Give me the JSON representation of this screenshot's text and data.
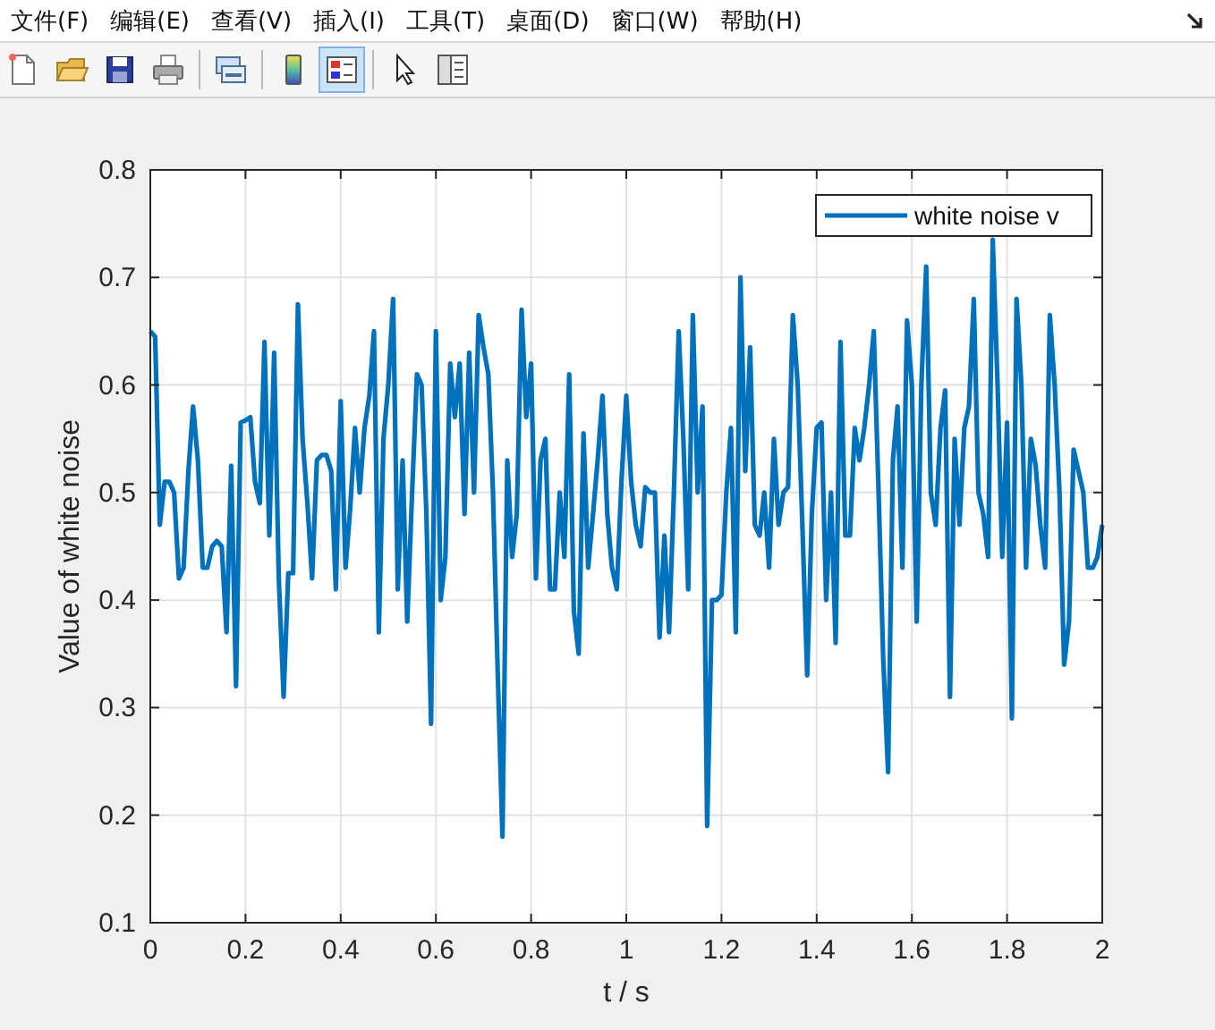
{
  "menu": [
    "文件(F)",
    "编辑(E)",
    "查看(V)",
    "插入(I)",
    "工具(T)",
    "桌面(D)",
    "窗口(W)",
    "帮助(H)"
  ],
  "toolbar": [
    {
      "kind": "new",
      "selected": false
    },
    {
      "kind": "open",
      "selected": false
    },
    {
      "kind": "save",
      "selected": false
    },
    {
      "kind": "print",
      "selected": false
    },
    {
      "kind": "separator"
    },
    {
      "kind": "link",
      "selected": false
    },
    {
      "kind": "separator"
    },
    {
      "kind": "colorbar",
      "selected": false
    },
    {
      "kind": "legend",
      "selected": true
    },
    {
      "kind": "separator"
    },
    {
      "kind": "pointer",
      "selected": false
    },
    {
      "kind": "inspector",
      "selected": false
    }
  ],
  "plot": {
    "chart_data": {
      "type": "line",
      "grid": true,
      "xlabel": "t / s",
      "ylabel": "Value of white noise",
      "xlim": [
        0,
        2
      ],
      "ylim": [
        0.1,
        0.8
      ],
      "xticks": [
        0,
        0.2,
        0.4,
        0.6,
        0.8,
        1,
        1.2,
        1.4,
        1.6,
        1.8,
        2
      ],
      "yticks": [
        0.1,
        0.2,
        0.3,
        0.4,
        0.5,
        0.6,
        0.7,
        0.8
      ],
      "x": [
        0,
        0.01,
        0.02,
        0.03,
        0.04,
        0.05,
        0.06,
        0.07,
        0.08,
        0.09,
        0.1,
        0.11,
        0.12,
        0.13,
        0.14,
        0.15,
        0.16,
        0.17,
        0.18,
        0.19,
        0.2,
        0.21,
        0.22,
        0.23,
        0.24,
        0.25,
        0.26,
        0.27,
        0.28,
        0.29,
        0.3,
        0.31,
        0.32,
        0.33,
        0.34,
        0.35,
        0.36,
        0.37,
        0.38,
        0.39,
        0.4,
        0.41,
        0.42,
        0.43,
        0.44,
        0.45,
        0.46,
        0.47,
        0.48,
        0.49,
        0.5,
        0.51,
        0.52,
        0.53,
        0.54,
        0.55,
        0.56,
        0.57,
        0.58,
        0.59,
        0.6,
        0.61,
        0.62,
        0.63,
        0.64,
        0.65,
        0.66,
        0.67,
        0.68,
        0.69,
        0.7,
        0.71,
        0.72,
        0.73,
        0.74,
        0.75,
        0.76,
        0.77,
        0.78,
        0.79,
        0.8,
        0.81,
        0.82,
        0.83,
        0.84,
        0.85,
        0.86,
        0.87,
        0.88,
        0.89,
        0.9,
        0.91,
        0.92,
        0.93,
        0.94,
        0.95,
        0.96,
        0.97,
        0.98,
        0.99,
        1,
        1.01,
        1.02,
        1.03,
        1.04,
        1.05,
        1.06,
        1.07,
        1.08,
        1.09,
        1.1,
        1.11,
        1.12,
        1.13,
        1.14,
        1.15,
        1.16,
        1.17,
        1.18,
        1.19,
        1.2,
        1.21,
        1.22,
        1.23,
        1.24,
        1.25,
        1.26,
        1.27,
        1.28,
        1.29,
        1.3,
        1.31,
        1.32,
        1.33,
        1.34,
        1.35,
        1.36,
        1.37,
        1.38,
        1.39,
        1.4,
        1.41,
        1.42,
        1.43,
        1.44,
        1.45,
        1.46,
        1.47,
        1.48,
        1.49,
        1.5,
        1.51,
        1.52,
        1.53,
        1.54,
        1.55,
        1.56,
        1.57,
        1.58,
        1.59,
        1.6,
        1.61,
        1.62,
        1.63,
        1.64,
        1.65,
        1.66,
        1.67,
        1.68,
        1.69,
        1.7,
        1.71,
        1.72,
        1.73,
        1.74,
        1.75,
        1.76,
        1.77,
        1.78,
        1.79,
        1.8,
        1.81,
        1.82,
        1.83,
        1.84,
        1.85,
        1.86,
        1.87,
        1.88,
        1.89,
        1.9,
        1.91,
        1.92,
        1.93,
        1.94,
        1.95,
        1.96,
        1.97,
        1.98,
        1.99,
        2
      ],
      "series": [
        {
          "name": "white noise v",
          "color": "#0072bd",
          "values": [
            0.65,
            0.645,
            0.47,
            0.51,
            0.51,
            0.5,
            0.42,
            0.43,
            0.52,
            0.58,
            0.53,
            0.43,
            0.43,
            0.45,
            0.455,
            0.45,
            0.37,
            0.525,
            0.32,
            0.565,
            0.567,
            0.57,
            0.51,
            0.49,
            0.64,
            0.46,
            0.63,
            0.42,
            0.31,
            0.425,
            0.425,
            0.675,
            0.55,
            0.49,
            0.42,
            0.53,
            0.535,
            0.535,
            0.52,
            0.41,
            0.585,
            0.43,
            0.485,
            0.56,
            0.5,
            0.56,
            0.59,
            0.65,
            0.37,
            0.55,
            0.6,
            0.68,
            0.41,
            0.53,
            0.38,
            0.5,
            0.61,
            0.6,
            0.48,
            0.285,
            0.65,
            0.4,
            0.44,
            0.62,
            0.57,
            0.62,
            0.48,
            0.63,
            0.5,
            0.665,
            0.635,
            0.61,
            0.5,
            0.33,
            0.18,
            0.53,
            0.44,
            0.48,
            0.67,
            0.57,
            0.62,
            0.42,
            0.53,
            0.55,
            0.41,
            0.41,
            0.5,
            0.44,
            0.61,
            0.39,
            0.35,
            0.555,
            0.43,
            0.48,
            0.53,
            0.59,
            0.48,
            0.43,
            0.41,
            0.51,
            0.59,
            0.51,
            0.47,
            0.45,
            0.505,
            0.5,
            0.5,
            0.365,
            0.46,
            0.37,
            0.5,
            0.65,
            0.55,
            0.41,
            0.665,
            0.5,
            0.58,
            0.19,
            0.4,
            0.4,
            0.405,
            0.5,
            0.56,
            0.37,
            0.7,
            0.52,
            0.635,
            0.47,
            0.46,
            0.5,
            0.43,
            0.55,
            0.47,
            0.5,
            0.505,
            0.665,
            0.6,
            0.47,
            0.33,
            0.48,
            0.56,
            0.565,
            0.4,
            0.5,
            0.36,
            0.64,
            0.46,
            0.46,
            0.56,
            0.53,
            0.56,
            0.6,
            0.65,
            0.5,
            0.345,
            0.24,
            0.53,
            0.58,
            0.43,
            0.66,
            0.6,
            0.38,
            0.6,
            0.71,
            0.5,
            0.47,
            0.56,
            0.595,
            0.31,
            0.55,
            0.47,
            0.56,
            0.58,
            0.68,
            0.5,
            0.48,
            0.44,
            0.735,
            0.6,
            0.44,
            0.565,
            0.29,
            0.68,
            0.6,
            0.43,
            0.55,
            0.525,
            0.47,
            0.43,
            0.665,
            0.6,
            0.5,
            0.34,
            0.38,
            0.54,
            0.52,
            0.5,
            0.43,
            0.43,
            0.44,
            0.47
          ]
        }
      ]
    }
  }
}
